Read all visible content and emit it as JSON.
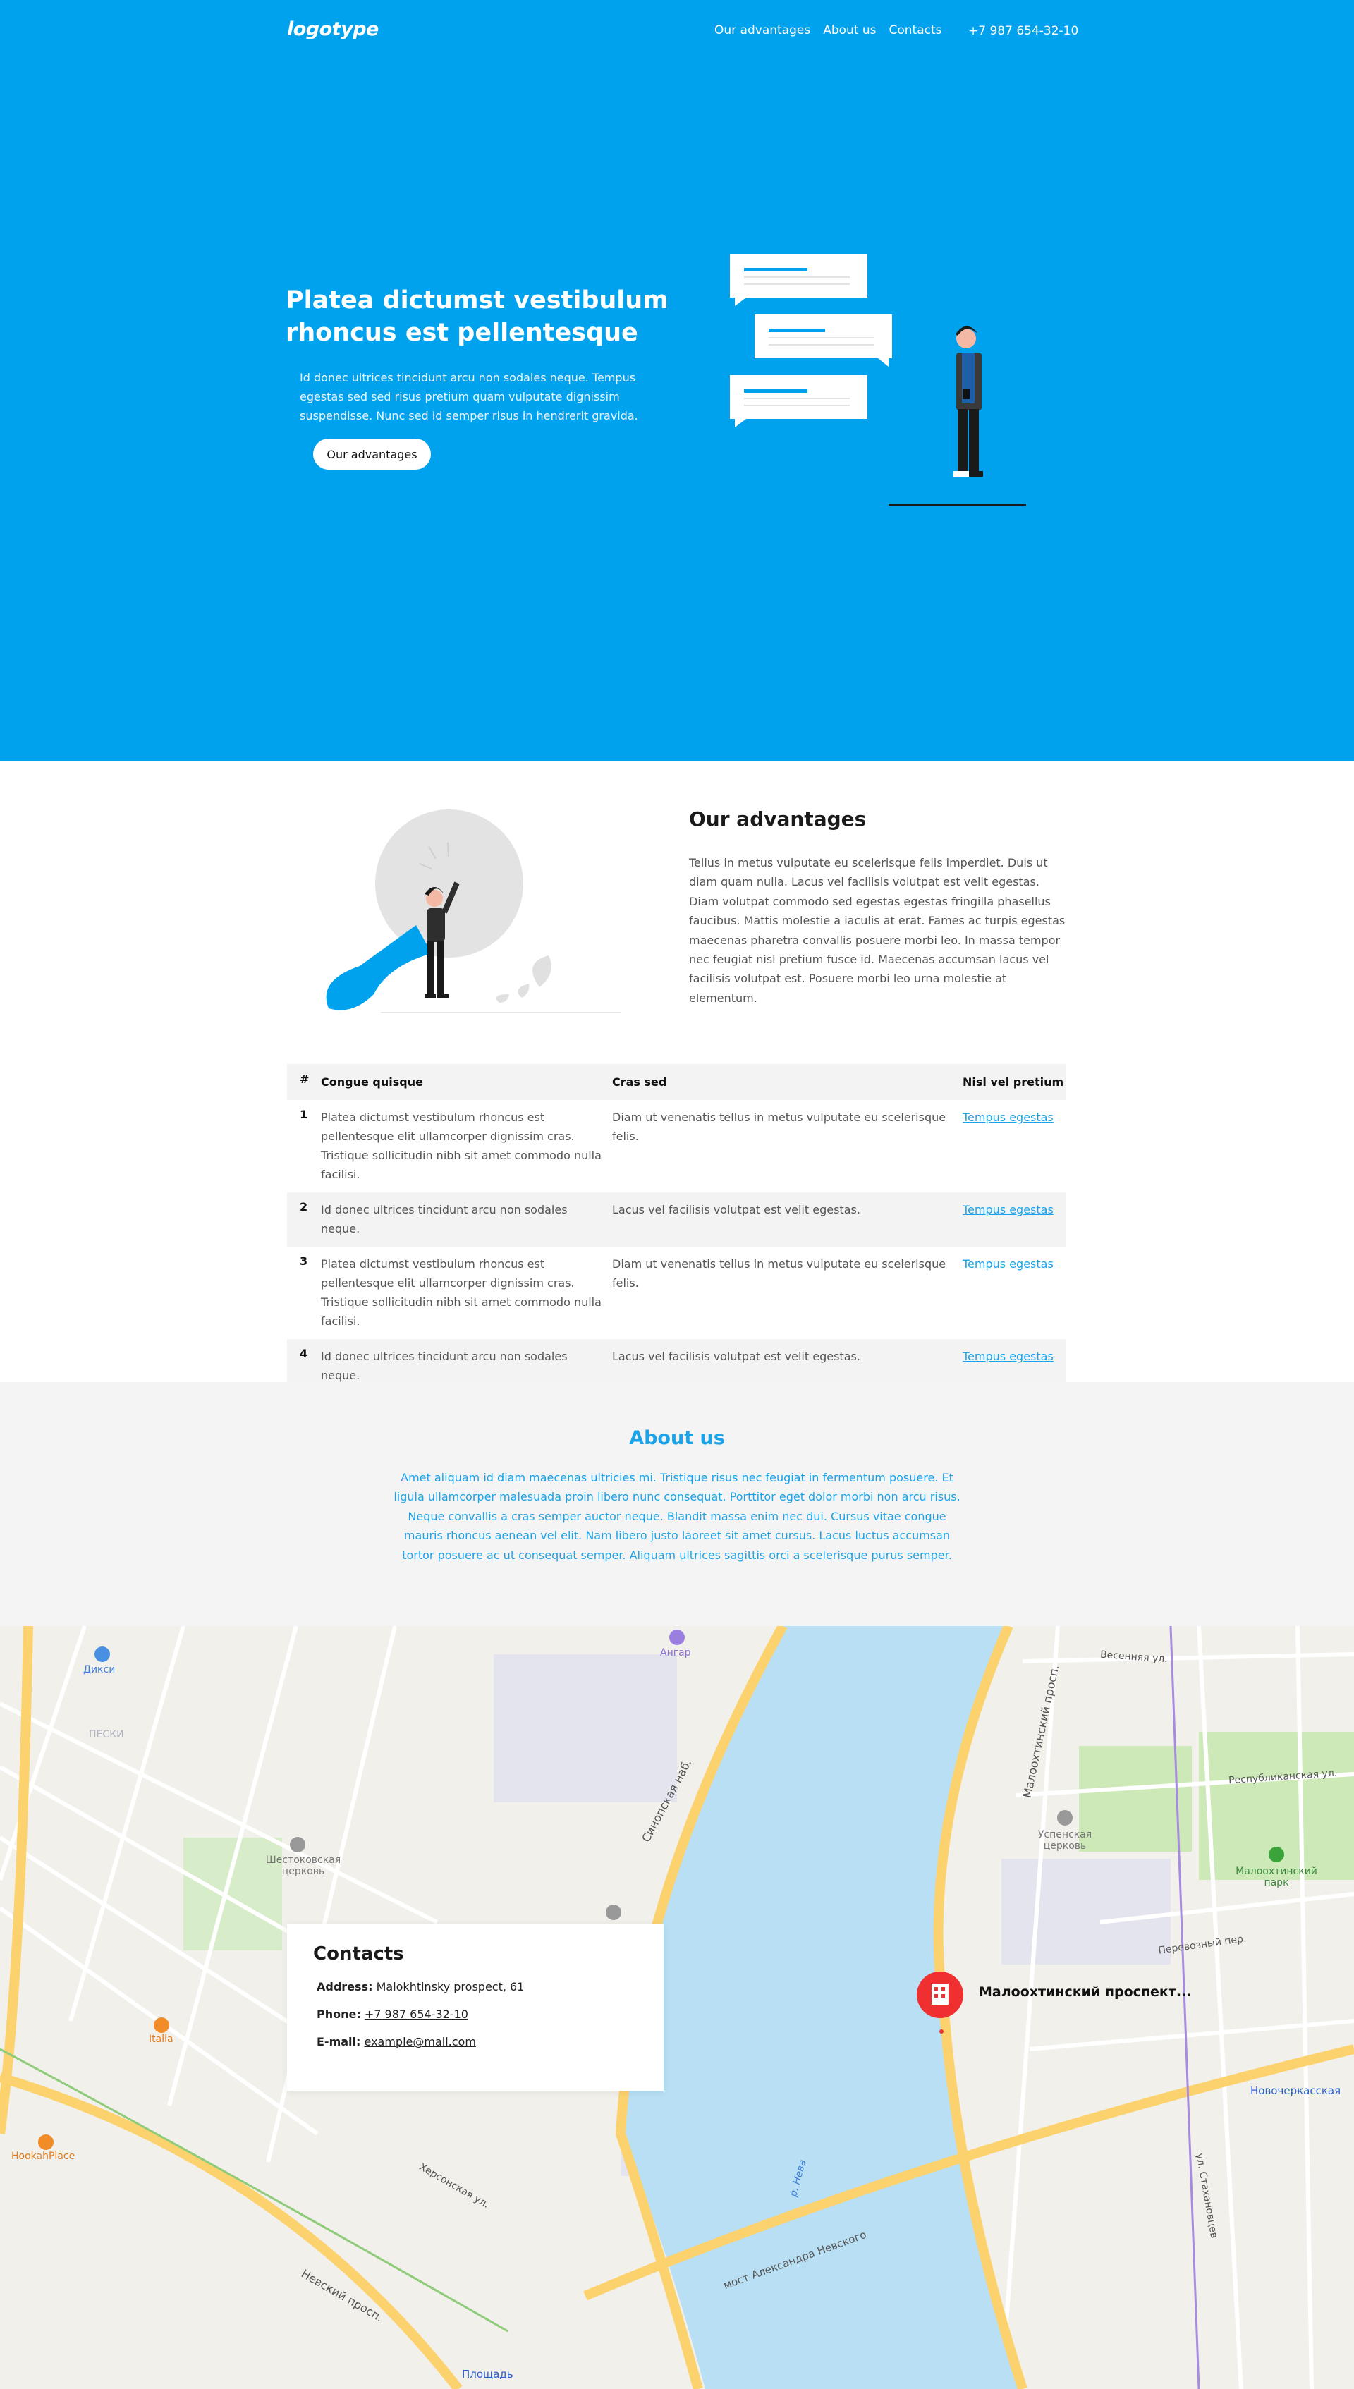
{
  "header": {
    "logo": "logotype",
    "nav": [
      "Our advantages",
      "About us",
      "Contacts"
    ],
    "phone": "+7 987 654-32-10"
  },
  "hero": {
    "title": "Platea dictumst vestibulum rhoncus est pellentesque",
    "text": "Id donec ultrices tincidunt arcu non sodales neque. Tempus egestas sed sed risus pretium quam vulputate dignissim suspendisse. Nunc sed id semper risus in hendrerit gravida.",
    "button": "Our advantages"
  },
  "advantages": {
    "title": "Our advantages",
    "text": "Tellus in metus vulputate eu scelerisque felis imperdiet. Duis ut diam quam nulla. Lacus vel facilisis volutpat est velit egestas. Diam volutpat commodo sed egestas egestas fringilla phasellus faucibus. Mattis molestie a iaculis at erat. Fames ac turpis egestas maecenas pharetra convallis posuere morbi leo. In massa tempor nec feugiat nisl pretium fusce id. Maecenas accumsan lacus vel facilisis volutpat est. Posuere morbi leo urna molestie at elementum."
  },
  "table": {
    "headers": [
      "#",
      "Congue quisque",
      "Cras sed",
      "Nisl vel pretium"
    ],
    "rows": [
      {
        "num": "1",
        "a": "Platea dictumst vestibulum rhoncus est pellentesque elit ullamcorper dignissim cras. Tristique sollicitudin nibh sit amet commodo nulla facilisi.",
        "b": "Diam ut venenatis tellus in metus vulputate eu scelerisque felis.",
        "link": "Tempus egestas"
      },
      {
        "num": "2",
        "a": "Id donec ultrices tincidunt arcu non sodales neque.",
        "b": "Lacus vel facilisis volutpat est velit egestas.",
        "link": "Tempus egestas"
      },
      {
        "num": "3",
        "a": "Platea dictumst vestibulum rhoncus est pellentesque elit ullamcorper dignissim cras. Tristique sollicitudin nibh sit amet commodo nulla facilisi.",
        "b": "Diam ut venenatis tellus in metus vulputate eu scelerisque felis.",
        "link": "Tempus egestas"
      },
      {
        "num": "4",
        "a": "Id donec ultrices tincidunt arcu non sodales neque.",
        "b": "Lacus vel facilisis volutpat est velit egestas.",
        "link": "Tempus egestas"
      }
    ]
  },
  "about": {
    "title": "About us",
    "text": "Amet aliquam id diam maecenas ultricies mi. Tristique risus nec feugiat in fermentum posuere. Et ligula ullamcorper malesuada proin libero nunc consequat. Porttitor eget dolor morbi non arcu risus. Neque convallis a cras semper auctor neque. Blandit massa enim nec dui. Cursus vitae congue mauris rhoncus aenean vel elit. Nam libero justo laoreet sit amet cursus. Lacus luctus accumsan tortor posuere ac ut consequat semper. Aliquam ultrices sagittis orci a scelerisque purus semper."
  },
  "contacts": {
    "title": "Contacts",
    "address_label": "Address:",
    "address": "Malokhtinsky prospect, 61",
    "phone_label": "Phone:",
    "phone": "+7 987 654-32-10",
    "email_label": "E-mail:",
    "email": "example@mail.com"
  },
  "map": {
    "marker_label": "Малоохтинский проспект...",
    "labels": {
      "dixi": "Дикси",
      "angar": "Ангар",
      "peski": "ПЕСКИ",
      "church1": "Шестоковская церковь",
      "church2": "Успенская церковь",
      "park": "Малоохтинский парк",
      "italia": "Italia",
      "hookah": "HookahPlace",
      "metro1": "Новочеркасская",
      "metro2": "Площадь",
      "river": "р. Нева",
      "street1": "Синопская наб.",
      "street2": "Малоохтинский просп.",
      "street3": "Невский просп.",
      "street4": "мост Александра Невского",
      "street5": "Херсонская ул.",
      "street6": "Республиканская ул.",
      "street7": "Весенняя ул.",
      "street8": "Перевозный пер.",
      "street9": "ул. Стахановцев"
    }
  },
  "colors": {
    "primary": "#00a2ee",
    "link": "#1aa3e8",
    "river": "#b8dff4",
    "marker": "#f03030"
  }
}
